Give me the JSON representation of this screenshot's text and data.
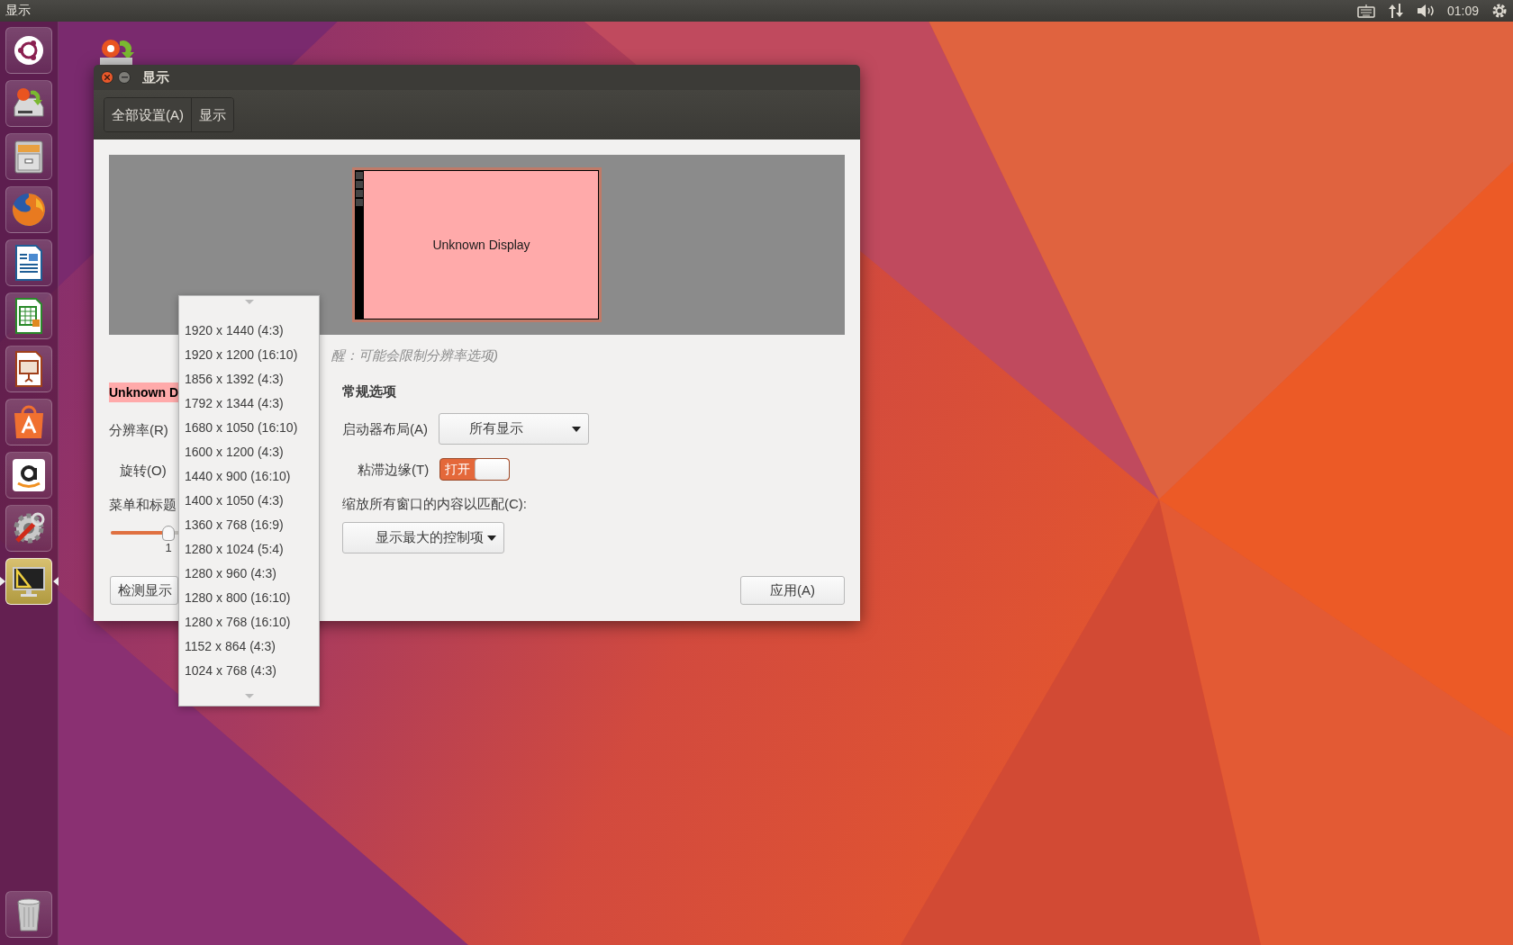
{
  "top_bar": {
    "app_title": "显示",
    "clock": "01:09"
  },
  "launcher": [
    {
      "kind": "logo",
      "active": false
    },
    {
      "kind": "installer",
      "active": false
    },
    {
      "kind": "files",
      "active": false
    },
    {
      "kind": "browser",
      "active": false
    },
    {
      "kind": "writer",
      "active": false
    },
    {
      "kind": "calc",
      "active": false
    },
    {
      "kind": "impress",
      "active": false
    },
    {
      "kind": "store",
      "active": false
    },
    {
      "kind": "shop",
      "active": false
    },
    {
      "kind": "settings",
      "active": false
    },
    {
      "kind": "display",
      "active": true
    }
  ],
  "window": {
    "title": "显示",
    "breadcrumbs": [
      "全部设置(A)",
      "显示"
    ]
  },
  "preview": {
    "display_name": "Unknown Display"
  },
  "hint": "醒：可能会限制分辨率选项)",
  "display_settings": {
    "name": "Unknown D",
    "resolution_label": "分辨率(R)",
    "rotation_label": "旋转(O)",
    "scale_label": "菜单和标题",
    "scale_slider": {
      "level": 0.31,
      "reading": "1"
    },
    "detect_button": "检测显示"
  },
  "general": {
    "heading": "常规选项",
    "launcher_label": "启动器布局(A)",
    "launcher_value": "所有显示",
    "sticky_label": "粘滞边缘(T)",
    "sticky_switch": {
      "label": "打开",
      "on": true
    },
    "scale_all_label": "缩放所有窗口的内容以匹配(C):",
    "scale_all_value": "显示最大的控制项"
  },
  "apply_button": "应用(A)",
  "resolution_menu": {
    "items": [
      "1920 x 1440 (4:3)",
      "1920 x 1200 (16:10)",
      "1856 x 1392 (4:3)",
      "1792 x 1344 (4:3)",
      "1680 x 1050 (16:10)",
      "1600 x 1200 (4:3)",
      "1440 x 900 (16:10)",
      "1400 x 1050 (4:3)",
      "1360 x 768 (16:9)",
      "1280 x 1024 (5:4)",
      "1280 x 960 (4:3)",
      "1280 x 800 (16:10)",
      "1280 x 768 (16:10)",
      "1152 x 864 (4:3)",
      "1024 x 768 (4:3)"
    ]
  }
}
